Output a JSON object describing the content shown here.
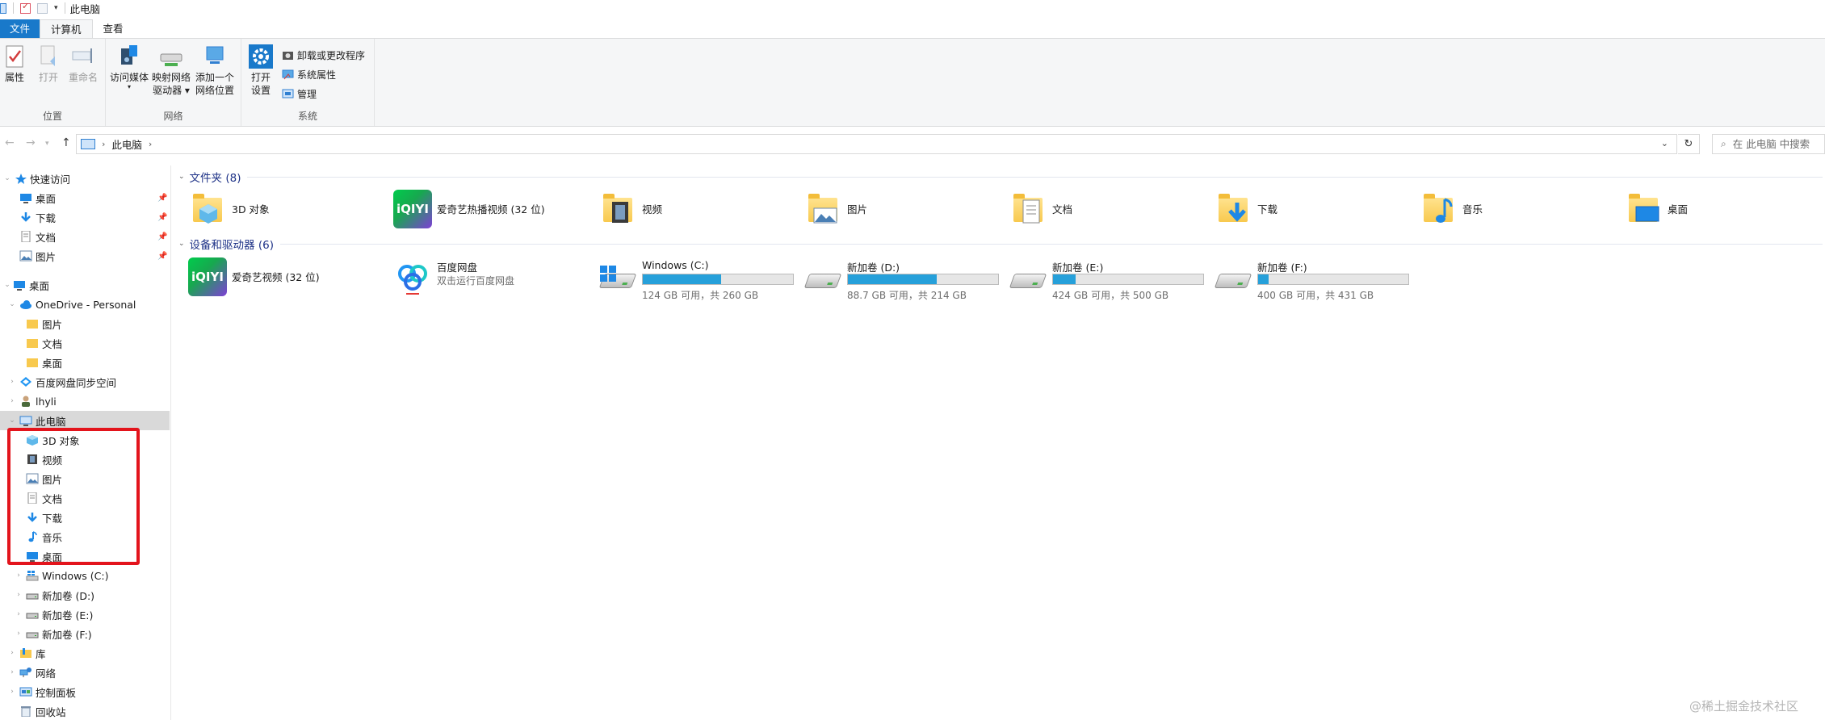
{
  "window": {
    "title": "此电脑"
  },
  "ribbon": {
    "tabs": [
      "文件",
      "计算机",
      "查看"
    ],
    "groups": {
      "location": {
        "label": "位置",
        "properties": "属性",
        "open": "打开",
        "rename": "重命名"
      },
      "network": {
        "label": "网络",
        "media_line1": "访问媒体",
        "map_line1": "映射网络",
        "map_line2": "驱动器",
        "add_line1": "添加一个",
        "add_line2": "网络位置"
      },
      "system": {
        "label": "系统",
        "settings_line1": "打开",
        "settings_line2": "设置",
        "uninstall": "卸载或更改程序",
        "system_props": "系统属性",
        "manage": "管理"
      }
    }
  },
  "address": {
    "crumb": "此电脑",
    "refresh_glyph": "↻",
    "search_placeholder": "在 此电脑 中搜索"
  },
  "nav": {
    "quick_access": "快速访问",
    "quick_items": [
      "桌面",
      "下载",
      "文档",
      "图片"
    ],
    "desktop": "桌面",
    "onedrive": "OneDrive - Personal",
    "onedrive_items": [
      "图片",
      "文档",
      "桌面"
    ],
    "baidu_sync": "百度网盘同步空间",
    "user": "lhyli",
    "this_pc": "此电脑",
    "pc_items": [
      "3D 对象",
      "视频",
      "图片",
      "文档",
      "下载",
      "音乐",
      "桌面"
    ],
    "drives": [
      "Windows (C:)",
      "新加卷 (D:)",
      "新加卷 (E:)",
      "新加卷 (F:)"
    ],
    "library": "库",
    "network": "网络",
    "control_panel": "控制面板",
    "recycle_bin": "回收站"
  },
  "content": {
    "folders_header": "文件夹 (8)",
    "folders": [
      "3D 对象",
      "爱奇艺热播视频 (32 位)",
      "视频",
      "图片",
      "文档",
      "下载",
      "音乐",
      "桌面"
    ],
    "devices_header": "设备和驱动器 (6)",
    "apps": [
      {
        "name": "爱奇艺视频 (32 位)",
        "sub": ""
      },
      {
        "name": "百度网盘",
        "sub": "双击运行百度网盘"
      }
    ],
    "drives": [
      {
        "name": "Windows (C:)",
        "free": "124 GB 可用，共 260 GB",
        "used_fraction": 0.52
      },
      {
        "name": "新加卷 (D:)",
        "free": "88.7 GB 可用，共 214 GB",
        "used_fraction": 0.59
      },
      {
        "name": "新加卷 (E:)",
        "free": "424 GB 可用，共 500 GB",
        "used_fraction": 0.15
      },
      {
        "name": "新加卷 (F:)",
        "free": "400 GB 可用，共 431 GB",
        "used_fraction": 0.07
      }
    ],
    "iqiyi_logo_text": "iQIYI"
  },
  "watermark": "@稀土掘金技术社区",
  "colors": {
    "accent": "#1979ca",
    "drive_fill": "#26a0da",
    "section_header": "#1e3287",
    "highlight": "#e3141c"
  }
}
